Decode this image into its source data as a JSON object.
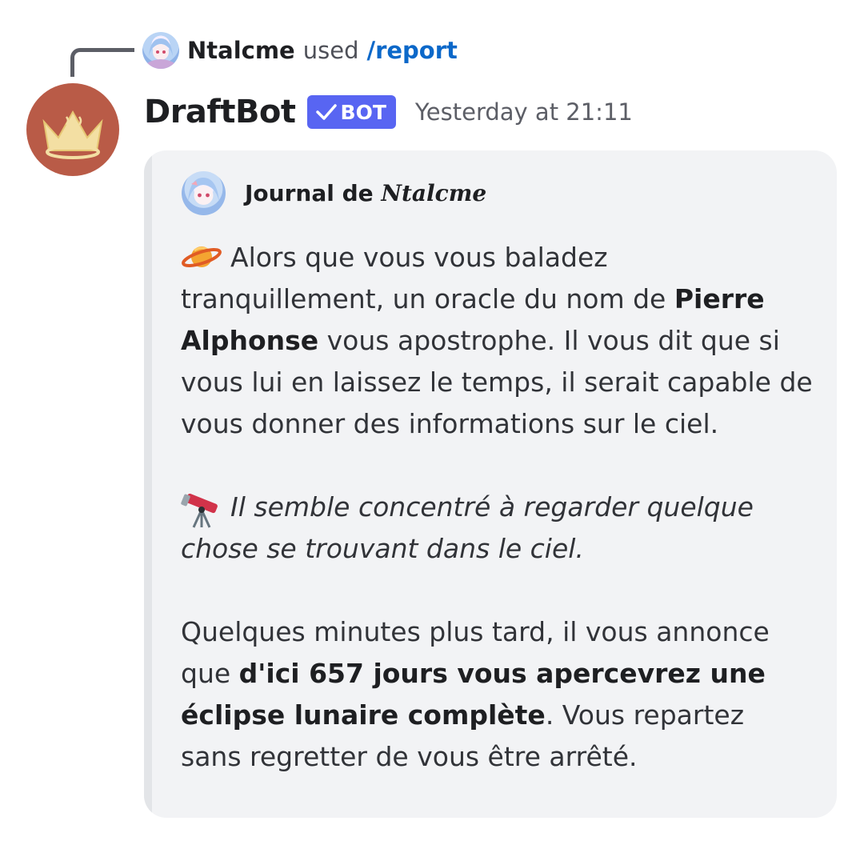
{
  "reply": {
    "user": "Ntalcme",
    "action": "used",
    "command": "/report"
  },
  "message": {
    "author": "DraftBot",
    "badge": "BOT",
    "timestamp": "Yesterday at 21:11"
  },
  "embed": {
    "author_prefix": "Journal de",
    "author_name": "Ntalcme",
    "paragraph1": {
      "emoji": "ringed-planet",
      "text1": "Alors que vous vous baladez tranquillement, un oracle du nom de",
      "bold": "Pierre Alphonse",
      "text2": "vous apostrophe. Il vous dit que si vous lui en laissez le temps, il serait capable de vous donner des informations sur le ciel."
    },
    "paragraph2": {
      "emoji": "telescope",
      "italic": "Il semble concentré à regarder quelque chose se trouvant dans le ciel."
    },
    "paragraph3": {
      "text1": "Quelques minutes plus tard, il vous annonce que",
      "bold": "d'ici 657 jours vous apercevrez une éclipse lunaire complète",
      "text2": ". Vous repartez sans regretter de vous être arrêté."
    }
  },
  "colors": {
    "bot_badge": "#5865f2",
    "command_link": "#0b68c9",
    "bot_avatar": "#b95b47",
    "embed_bg": "#f2f3f5"
  }
}
